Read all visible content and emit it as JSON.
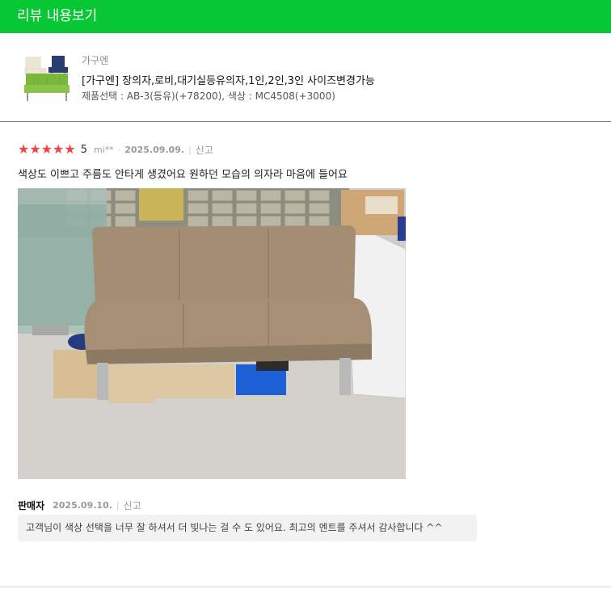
{
  "header": {
    "title": "리뷰 내용보기"
  },
  "product": {
    "brand": "가구엔",
    "name": "[가구엔] 장의자,로비,대기실등유의자,1인,2인,3인 사이즈변경가능",
    "option": "제품선택 : AB-3(등유)(+78200), 색상 : MC4508(+3000)",
    "thumbnail_icon": "sofa-thumbnail"
  },
  "review": {
    "rating": 5,
    "score_label": "5",
    "stars": [
      "★",
      "★",
      "★",
      "★",
      "★"
    ],
    "star_color": "#f1434b",
    "user_id": "mi**",
    "dot": "·",
    "date": "2025.09.09.",
    "separator": "|",
    "report_label": "신고",
    "text": "색상도 이쁘고 주름도 안타게 생겼어요 원하던 모습의 의자라 마음에 들어요"
  },
  "seller_reply": {
    "label": "판매자",
    "date": "2025.09.10.",
    "separator": "|",
    "report_label": "신고",
    "text": "고객님이 색상 선택을 너무 잘 하셔서 더 빛나는 걸 수 도 있어요. 최고의 멘트를 주셔서 감사합니다 ^^"
  },
  "colors": {
    "header_bg": "#08c734",
    "star": "#f1434b"
  }
}
